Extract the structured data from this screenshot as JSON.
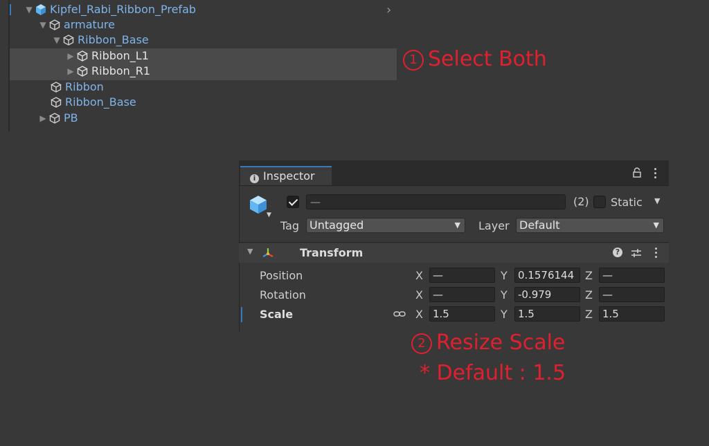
{
  "hierarchy": {
    "items": [
      {
        "label": "Kipfel_Rabi_Ribbon_Prefab",
        "expander": "▼",
        "color": "blue",
        "prefab": true
      },
      {
        "label": "armature",
        "expander": "▼",
        "color": "blue"
      },
      {
        "label": "Ribbon_Base",
        "expander": "▼",
        "color": "blue"
      },
      {
        "label": "Ribbon_L1",
        "expander": "▶",
        "color": "white"
      },
      {
        "label": "Ribbon_R1",
        "expander": "▶",
        "color": "white"
      },
      {
        "label": "Ribbon",
        "expander": "",
        "color": "blue"
      },
      {
        "label": "Ribbon_Base",
        "expander": "",
        "color": "blue"
      },
      {
        "label": "PB",
        "expander": "▶",
        "color": "blue"
      }
    ]
  },
  "annotations": {
    "step1_num": "1",
    "step1_text": "Select Both",
    "step2_num": "2",
    "step2_text": "Resize Scale",
    "step2_note": "* Default : 1.5"
  },
  "inspector": {
    "tab_label": "Inspector",
    "name_value": "—",
    "multi_count": "(2)",
    "static_label": "Static",
    "tag_label": "Tag",
    "tag_value": "Untagged",
    "layer_label": "Layer",
    "layer_value": "Default",
    "transform": {
      "title": "Transform",
      "rows": [
        {
          "label": "Position",
          "x": "—",
          "y": "0.1576144",
          "z": "—"
        },
        {
          "label": "Rotation",
          "x": "—",
          "y": "-0.979",
          "z": "—"
        },
        {
          "label": "Scale",
          "x": "1.5",
          "y": "1.5",
          "z": "1.5"
        }
      ],
      "axis_x": "X",
      "axis_y": "Y",
      "axis_z": "Z"
    }
  },
  "colors": {
    "annotation_red": "#e0202e",
    "accent_blue": "#3a79bb",
    "hierarchy_blue_text": "#7fb4ea"
  }
}
